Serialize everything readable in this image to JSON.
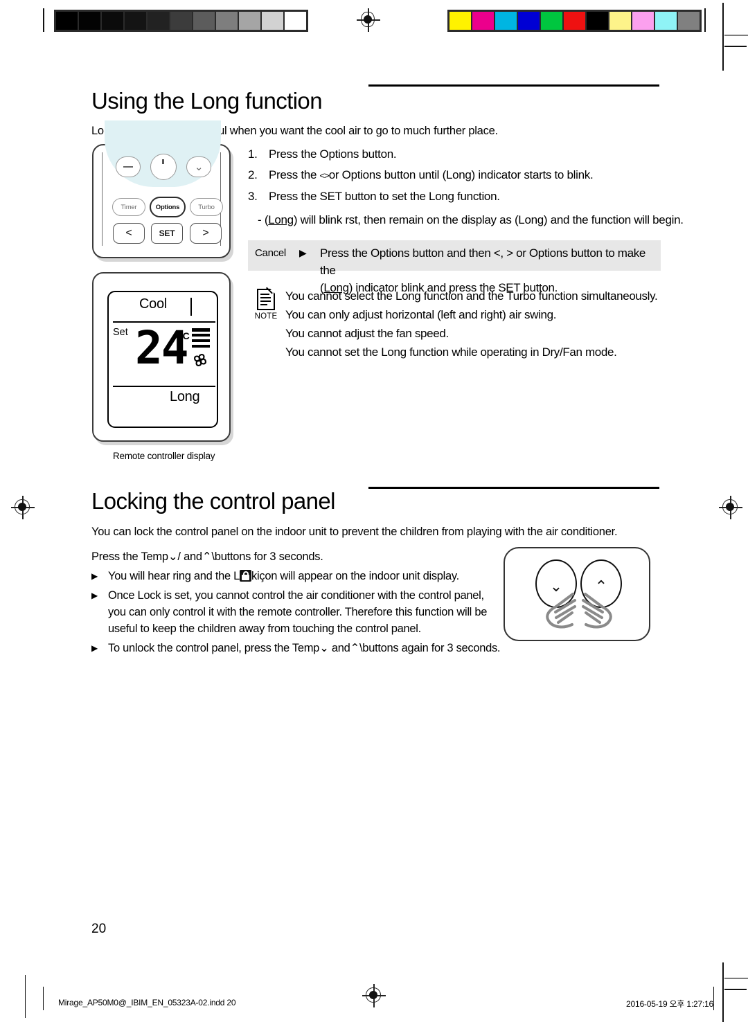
{
  "document": {
    "page_number": "20",
    "footer_left": "Mirage_AP50M0@_IBIM_EN_05323A-02.indd   20",
    "footer_right": "2016-05-19   오후 1:27:16"
  },
  "calibration": {
    "grayscale_swatches": [
      "#000000",
      "#030303",
      "#0b0b0b",
      "#141414",
      "#222222",
      "#3c3c3c",
      "#5c5c5c",
      "#7e7e7e",
      "#a5a5a5",
      "#d2d2d2",
      "#ffffff"
    ],
    "color_swatches": [
      "#fff200",
      "#ec008c",
      "#00b5e2",
      "#0000d4",
      "#00c63f",
      "#ee1111",
      "#000000",
      "#fdf38a",
      "#fba0ee",
      "#8ff3f6",
      "#808080"
    ]
  },
  "section1": {
    "title": "Using the Long function",
    "intro": "Long function will be helpful when you want the cool air to go to much further place.",
    "steps": [
      {
        "num": "1.",
        "text": "Press the Options button."
      },
      {
        "num": "2.",
        "text_before": "Press the ",
        "glyph": "<>",
        "text_after": "or Options button until (Long) indicator starts to blink."
      },
      {
        "num": "3.",
        "text": "Press the SET button to set the Long function."
      }
    ],
    "substep": {
      "dash": "-",
      "underlined": "Long",
      "before": "(",
      "after": ") will blink  rst, then remain on the display as (Long) and the function will begin."
    },
    "cancel": {
      "label": "Cancel",
      "marker": "▶",
      "line1_a": "Press the Options button and then <, > or Options button to make the",
      "line2_prefix": "(",
      "line2_underlined": "Long",
      "line2_rest": ") indicator blink and press the SET button."
    },
    "note": {
      "icon_label": "NOTE",
      "lines": [
        "You cannot select the Long function and the Turbo function simultaneously.",
        "You can only adjust horizontal (left and right) air swing.",
        "You cannot adjust the fan speed.",
        "You cannot set the Long function while operating in Dry/Fan mode."
      ]
    },
    "remote": {
      "buttons_row1": [
        "Timer",
        "Options",
        "Turbo"
      ],
      "buttons_row2": [
        "<",
        "SET",
        ">"
      ],
      "top_icons": [
        "minus-icon",
        "swing-icon",
        "chevron-down-icon"
      ]
    },
    "display": {
      "mode": "Cool",
      "set_label": "Set",
      "temperature": "24",
      "unit": "°C",
      "indicator": "Long",
      "caption": "Remote controller display"
    }
  },
  "section2": {
    "title": "Locking the control panel",
    "intro": "You can lock the control panel on the indoor unit to prevent the children from playing with the air conditioner.",
    "instruction": "Press the Temp⌄/ and⌃\\buttons for 3 seconds.",
    "bullets": [
      {
        "marker": "▶",
        "text_a": "You will hear ring and the L",
        "lock": "lock-icon",
        "text_b": "kiçon will appear on the indoor unit display."
      },
      {
        "marker": "▶",
        "text": "Once Lock is set, you cannot control the air conditioner with the control panel, you can only control it with the remote controller. Therefore this function will be useful to keep the children away from touching the control panel."
      },
      {
        "marker": "▶",
        "text": "To unlock the control panel, press the Temp⌄ and⌃\\buttons again for 3 seconds."
      }
    ],
    "panel_illustration": {
      "left_button": "⌄",
      "right_button": "⌃"
    }
  }
}
